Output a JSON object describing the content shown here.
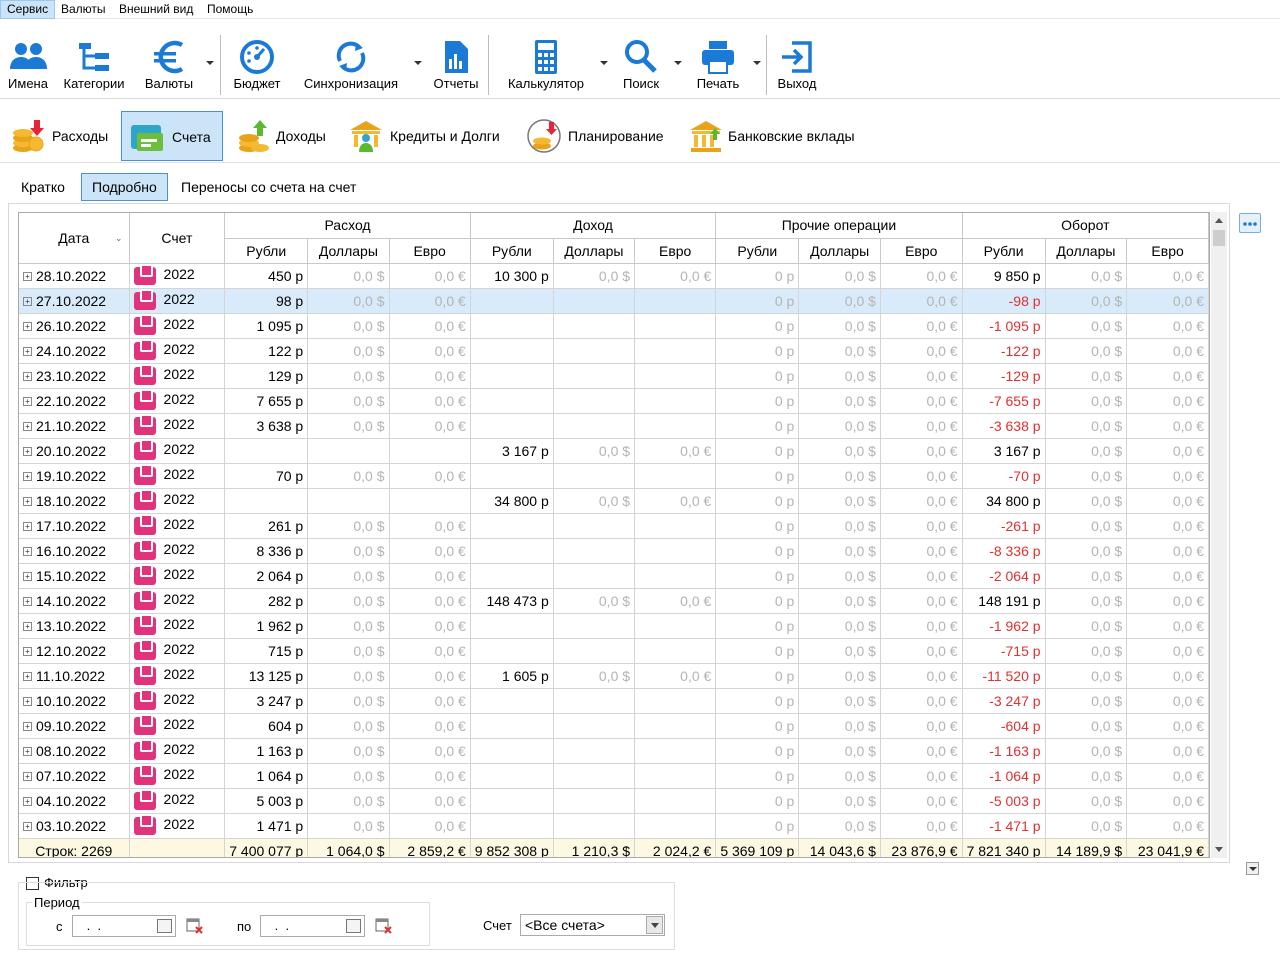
{
  "menu": [
    "Сервис",
    "Валюты",
    "Внешний вид",
    "Помощь"
  ],
  "toolbar": {
    "names": "Имена",
    "categories": "Категории",
    "currencies": "Валюты",
    "budget": "Бюджет",
    "sync": "Синхронизация",
    "reports": "Отчеты",
    "calculator": "Калькулятор",
    "search": "Поиск",
    "print": "Печать",
    "exit": "Выход"
  },
  "sections": {
    "expenses": "Расходы",
    "accounts": "Счета",
    "income": "Доходы",
    "credits": "Кредиты и Долги",
    "planning": "Планирование",
    "deposits": "Банковские вклады"
  },
  "views": {
    "brief": "Кратко",
    "detailed": "Подробно",
    "transfers": "Переносы со счета на счет"
  },
  "grid": {
    "col_date": "Дата",
    "col_account": "Счет",
    "groups": [
      "Расход",
      "Доход",
      "Прочие операции",
      "Оборот"
    ],
    "subcols": [
      "Рубли",
      "Доллары",
      "Евро"
    ],
    "rows": [
      [
        "28.10.2022",
        "2022",
        "450 р",
        "0,0 $",
        "0,0 €",
        "10 300 р",
        "0,0 $",
        "0,0 €",
        "0 р",
        "0,0 $",
        "0,0 €",
        "9 850 р",
        "0,0 $",
        "0,0 €"
      ],
      [
        "27.10.2022",
        "2022",
        "98 р",
        "0,0 $",
        "0,0 €",
        "",
        "",
        "",
        "0 р",
        "0,0 $",
        "0,0 €",
        "-98 р",
        "0,0 $",
        "0,0 €"
      ],
      [
        "26.10.2022",
        "2022",
        "1 095 р",
        "0,0 $",
        "0,0 €",
        "",
        "",
        "",
        "0 р",
        "0,0 $",
        "0,0 €",
        "-1 095 р",
        "0,0 $",
        "0,0 €"
      ],
      [
        "24.10.2022",
        "2022",
        "122 р",
        "0,0 $",
        "0,0 €",
        "",
        "",
        "",
        "0 р",
        "0,0 $",
        "0,0 €",
        "-122 р",
        "0,0 $",
        "0,0 €"
      ],
      [
        "23.10.2022",
        "2022",
        "129 р",
        "0,0 $",
        "0,0 €",
        "",
        "",
        "",
        "0 р",
        "0,0 $",
        "0,0 €",
        "-129 р",
        "0,0 $",
        "0,0 €"
      ],
      [
        "22.10.2022",
        "2022",
        "7 655 р",
        "0,0 $",
        "0,0 €",
        "",
        "",
        "",
        "0 р",
        "0,0 $",
        "0,0 €",
        "-7 655 р",
        "0,0 $",
        "0,0 €"
      ],
      [
        "21.10.2022",
        "2022",
        "3 638 р",
        "0,0 $",
        "0,0 €",
        "",
        "",
        "",
        "0 р",
        "0,0 $",
        "0,0 €",
        "-3 638 р",
        "0,0 $",
        "0,0 €"
      ],
      [
        "20.10.2022",
        "2022",
        "",
        "",
        "",
        "3 167 р",
        "0,0 $",
        "0,0 €",
        "0 р",
        "0,0 $",
        "0,0 €",
        "3 167 р",
        "0,0 $",
        "0,0 €"
      ],
      [
        "19.10.2022",
        "2022",
        "70 р",
        "0,0 $",
        "0,0 €",
        "",
        "",
        "",
        "0 р",
        "0,0 $",
        "0,0 €",
        "-70 р",
        "0,0 $",
        "0,0 €"
      ],
      [
        "18.10.2022",
        "2022",
        "",
        "",
        "",
        "34 800 р",
        "0,0 $",
        "0,0 €",
        "0 р",
        "0,0 $",
        "0,0 €",
        "34 800 р",
        "0,0 $",
        "0,0 €"
      ],
      [
        "17.10.2022",
        "2022",
        "261 р",
        "0,0 $",
        "0,0 €",
        "",
        "",
        "",
        "0 р",
        "0,0 $",
        "0,0 €",
        "-261 р",
        "0,0 $",
        "0,0 €"
      ],
      [
        "16.10.2022",
        "2022",
        "8 336 р",
        "0,0 $",
        "0,0 €",
        "",
        "",
        "",
        "0 р",
        "0,0 $",
        "0,0 €",
        "-8 336 р",
        "0,0 $",
        "0,0 €"
      ],
      [
        "15.10.2022",
        "2022",
        "2 064 р",
        "0,0 $",
        "0,0 €",
        "",
        "",
        "",
        "0 р",
        "0,0 $",
        "0,0 €",
        "-2 064 р",
        "0,0 $",
        "0,0 €"
      ],
      [
        "14.10.2022",
        "2022",
        "282 р",
        "0,0 $",
        "0,0 €",
        "148 473 р",
        "0,0 $",
        "0,0 €",
        "0 р",
        "0,0 $",
        "0,0 €",
        "148 191 р",
        "0,0 $",
        "0,0 €"
      ],
      [
        "13.10.2022",
        "2022",
        "1 962 р",
        "0,0 $",
        "0,0 €",
        "",
        "",
        "",
        "0 р",
        "0,0 $",
        "0,0 €",
        "-1 962 р",
        "0,0 $",
        "0,0 €"
      ],
      [
        "12.10.2022",
        "2022",
        "715 р",
        "0,0 $",
        "0,0 €",
        "",
        "",
        "",
        "0 р",
        "0,0 $",
        "0,0 €",
        "-715 р",
        "0,0 $",
        "0,0 €"
      ],
      [
        "11.10.2022",
        "2022",
        "13 125 р",
        "0,0 $",
        "0,0 €",
        "1 605 р",
        "0,0 $",
        "0,0 €",
        "0 р",
        "0,0 $",
        "0,0 €",
        "-11 520 р",
        "0,0 $",
        "0,0 €"
      ],
      [
        "10.10.2022",
        "2022",
        "3 247 р",
        "0,0 $",
        "0,0 €",
        "",
        "",
        "",
        "0 р",
        "0,0 $",
        "0,0 €",
        "-3 247 р",
        "0,0 $",
        "0,0 €"
      ],
      [
        "09.10.2022",
        "2022",
        "604 р",
        "0,0 $",
        "0,0 €",
        "",
        "",
        "",
        "0 р",
        "0,0 $",
        "0,0 €",
        "-604 р",
        "0,0 $",
        "0,0 €"
      ],
      [
        "08.10.2022",
        "2022",
        "1 163 р",
        "0,0 $",
        "0,0 €",
        "",
        "",
        "",
        "0 р",
        "0,0 $",
        "0,0 €",
        "-1 163 р",
        "0,0 $",
        "0,0 €"
      ],
      [
        "07.10.2022",
        "2022",
        "1 064 р",
        "0,0 $",
        "0,0 €",
        "",
        "",
        "",
        "0 р",
        "0,0 $",
        "0,0 €",
        "-1 064 р",
        "0,0 $",
        "0,0 €"
      ],
      [
        "04.10.2022",
        "2022",
        "5 003 р",
        "0,0 $",
        "0,0 €",
        "",
        "",
        "",
        "0 р",
        "0,0 $",
        "0,0 €",
        "-5 003 р",
        "0,0 $",
        "0,0 €"
      ],
      [
        "03.10.2022",
        "2022",
        "1 471 р",
        "0,0 $",
        "0,0 €",
        "",
        "",
        "",
        "0 р",
        "0,0 $",
        "0,0 €",
        "-1 471 р",
        "0,0 $",
        "0,0 €"
      ]
    ],
    "selected_row": 1,
    "footer": [
      "Строк: 2269",
      "",
      "7 400 077 р",
      "1 064,0 $",
      "2 859,2 €",
      "9 852 308 р",
      "1 210,3 $",
      "2 024,2 €",
      "5 369 109 р",
      "14 043,6 $",
      "23 876,9 €",
      "7 821 340 р",
      "14 189,9 $",
      "23 041,9 €"
    ]
  },
  "filter": {
    "label": "Фильтр",
    "checked": false,
    "period": "Период",
    "from": "с",
    "to": "по",
    "from_value": " .  .",
    "to_value": " .  .",
    "account_label": "Счет",
    "account_value": "<Все счета>"
  },
  "colors": {
    "accent": "#cce4f7",
    "accent_border": "#4a90d8",
    "negative": "#e03131",
    "icon_blue": "#1b7ad6",
    "wallet": "#e0337b",
    "footer_bg": "#fdf8e1"
  }
}
